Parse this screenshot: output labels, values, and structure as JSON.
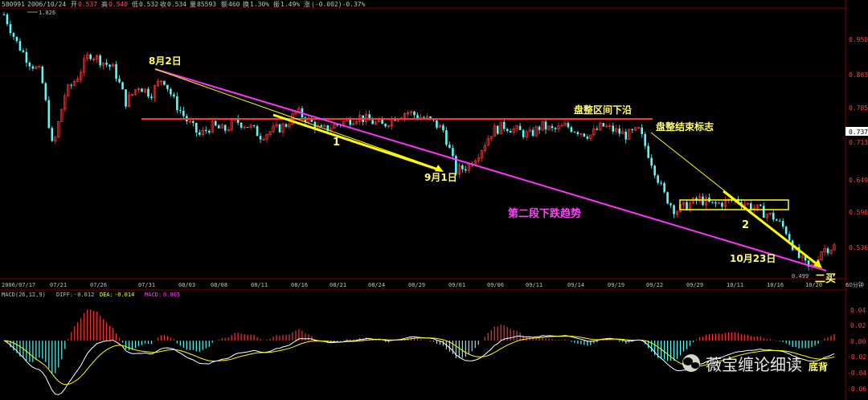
{
  "header": {
    "code": "580991",
    "date": "2006/10/24",
    "open_label": "开",
    "open": "0.537",
    "high_label": "高",
    "high": "0.540",
    "low_label": "低",
    "low": "0.532",
    "close_label": "收",
    "close": "0.534",
    "volume_label": "量",
    "volume": "85593",
    "amount_label": "额",
    "amount": "460",
    "turnover_label": "换",
    "turnover": "1.30%",
    "amplitude_label": "振",
    "amplitude": "1.49%",
    "change_label": "涨",
    "change": "(-0.002)-0.37%"
  },
  "price_axis": {
    "ticks": [
      "0.950",
      "0.863",
      "0.785",
      "0.713",
      "0.649",
      "0.590",
      "0.536"
    ],
    "current_price": "0.737"
  },
  "date_axis": {
    "labels": [
      "2006/07/17",
      "07/21",
      "07/26",
      "07/31",
      "08/03",
      "08/08",
      "08/11",
      "08/16",
      "08/21",
      "08/24",
      "08/29",
      "09/01",
      "09/06",
      "09/11",
      "09/14",
      "09/19",
      "09/22",
      "09/29",
      "10/11",
      "10/16",
      "10/20"
    ],
    "right_label": "60分钟"
  },
  "extremes": {
    "high": "1.026",
    "low": "0.499"
  },
  "annotations": {
    "aug2": "8月2日",
    "sep1": "9月1日",
    "oct23": "10月23日",
    "range_low": "盘整区间下沿",
    "range_end": "盘整结束标志",
    "second_leg": "第二段下跌趋势",
    "label_1": "1",
    "label_2": "2",
    "buy": "二买",
    "macd_note": "底背"
  },
  "macd": {
    "title": "MACD(26,12,9)",
    "diff_label": "DIFF:",
    "diff": "-0.012",
    "dea_label": "DEA:",
    "dea": "-0.014",
    "macd_label": "MACD:",
    "macd": "0.005",
    "ticks": [
      "0.04",
      "0.02",
      "0.00",
      "-0.02",
      "-0.04",
      "-0.06"
    ]
  },
  "watermark": "薇宝缠论细读",
  "colors": {
    "up": "#ff3232",
    "down": "#54fcfc",
    "accent_line": "#ffff00",
    "trend_line": "#ff33ff",
    "range_line": "#ff3232",
    "text": "#ffff66"
  },
  "chart_data": {
    "type": "candlestick",
    "interval": "60分钟",
    "ylim": [
      0.49,
      1.04
    ],
    "price_close_path": [
      1.026,
      0.95,
      0.9,
      0.87,
      0.7,
      0.82,
      0.86,
      0.92,
      0.9,
      0.88,
      0.8,
      0.84,
      0.82,
      0.86,
      0.8,
      0.76,
      0.73,
      0.75,
      0.74,
      0.76,
      0.75,
      0.73,
      0.74,
      0.75,
      0.78,
      0.76,
      0.74,
      0.75,
      0.76,
      0.77,
      0.76,
      0.75,
      0.77,
      0.78,
      0.77,
      0.76,
      0.74,
      0.66,
      0.67,
      0.7,
      0.74,
      0.75,
      0.74,
      0.73,
      0.75,
      0.74,
      0.75,
      0.74,
      0.73,
      0.75,
      0.74,
      0.73,
      0.74,
      0.68,
      0.62,
      0.59,
      0.6,
      0.61,
      0.6,
      0.605,
      0.61,
      0.6,
      0.59,
      0.58,
      0.56,
      0.52,
      0.5,
      0.53,
      0.534
    ],
    "key_points": [
      {
        "label": "8月2日",
        "value": 0.87
      },
      {
        "label": "9月1日",
        "value": 0.66
      },
      {
        "label": "10月23日",
        "value": 0.499
      }
    ],
    "range_lower_edge": 0.765
  }
}
